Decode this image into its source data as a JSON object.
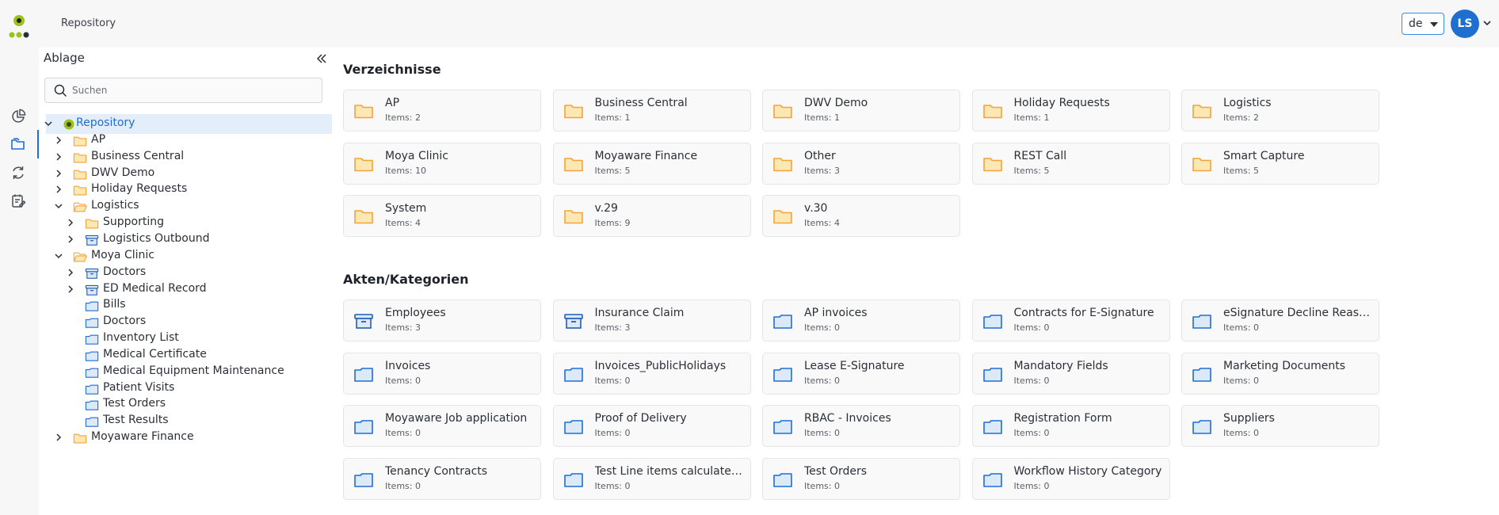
{
  "header": {
    "breadcrumb": "Repository",
    "language": "de",
    "avatar_initials": "LS"
  },
  "colors": {
    "accent": "#1f6fd1",
    "folder_yellow": "#f2a33a",
    "category_blue": "#1f6fd1",
    "selected_bg": "#e3eefa",
    "logo_lime": "#9bc21b"
  },
  "rail": {
    "items": [
      {
        "icon": "dashboard-icon"
      },
      {
        "icon": "folders-icon",
        "active": true
      },
      {
        "icon": "refresh-cycle-icon"
      },
      {
        "icon": "task-list-icon"
      }
    ]
  },
  "sidebar": {
    "title": "Ablage",
    "search_placeholder": "Suchen",
    "tree": [
      {
        "label": "Repository",
        "type": "root",
        "depth": 0,
        "expanded": true,
        "selected": true
      },
      {
        "label": "AP",
        "type": "folder",
        "depth": 1,
        "expanded": false
      },
      {
        "label": "Business Central",
        "type": "folder",
        "depth": 1,
        "expanded": false
      },
      {
        "label": "DWV Demo",
        "type": "folder",
        "depth": 1,
        "expanded": false
      },
      {
        "label": "Holiday Requests",
        "type": "folder",
        "depth": 1,
        "expanded": false
      },
      {
        "label": "Logistics",
        "type": "folder-open",
        "depth": 1,
        "expanded": true
      },
      {
        "label": "Supporting",
        "type": "folder",
        "depth": 2,
        "expanded": false
      },
      {
        "label": "Logistics Outbound",
        "type": "archive",
        "depth": 2,
        "expanded": false
      },
      {
        "label": "Moya Clinic",
        "type": "folder-open",
        "depth": 1,
        "expanded": true
      },
      {
        "label": "Doctors",
        "type": "archive",
        "depth": 2,
        "expanded": false
      },
      {
        "label": "ED Medical Record",
        "type": "archive",
        "depth": 2,
        "expanded": false
      },
      {
        "label": "Bills",
        "type": "category",
        "depth": 2,
        "leaf": true
      },
      {
        "label": "Doctors",
        "type": "category",
        "depth": 2,
        "leaf": true
      },
      {
        "label": "Inventory List",
        "type": "category",
        "depth": 2,
        "leaf": true
      },
      {
        "label": "Medical Certificate",
        "type": "category",
        "depth": 2,
        "leaf": true
      },
      {
        "label": "Medical Equipment Maintenance",
        "type": "category",
        "depth": 2,
        "leaf": true
      },
      {
        "label": "Patient Visits",
        "type": "category",
        "depth": 2,
        "leaf": true
      },
      {
        "label": "Test Orders",
        "type": "category",
        "depth": 2,
        "leaf": true
      },
      {
        "label": "Test Results",
        "type": "category",
        "depth": 2,
        "leaf": true
      },
      {
        "label": "Moyaware Finance",
        "type": "folder",
        "depth": 1,
        "expanded": false
      }
    ]
  },
  "main": {
    "directories_title": "Verzeichnisse",
    "directories": [
      {
        "name": "AP",
        "count": "Items: 2"
      },
      {
        "name": "Business Central",
        "count": "Items: 1"
      },
      {
        "name": "DWV Demo",
        "count": "Items: 1"
      },
      {
        "name": "Holiday Requests",
        "count": "Items: 1"
      },
      {
        "name": "Logistics",
        "count": "Items: 2"
      },
      {
        "name": "Moya Clinic",
        "count": "Items: 10"
      },
      {
        "name": "Moyaware Finance",
        "count": "Items: 5"
      },
      {
        "name": "Other",
        "count": "Items: 3"
      },
      {
        "name": "REST Call",
        "count": "Items: 5"
      },
      {
        "name": "Smart Capture",
        "count": "Items: 5"
      },
      {
        "name": "System",
        "count": "Items: 4"
      },
      {
        "name": "v.29",
        "count": "Items: 9"
      },
      {
        "name": "v.30",
        "count": "Items: 4"
      }
    ],
    "categories_title": "Akten/Kategorien",
    "categories": [
      {
        "name": "Employees",
        "count": "Items: 3",
        "icon": "archive-icon"
      },
      {
        "name": "Insurance Claim",
        "count": "Items: 3",
        "icon": "archive-icon"
      },
      {
        "name": "AP invoices",
        "count": "Items: 0",
        "icon": "category-folder-icon"
      },
      {
        "name": "Contracts for E-Signature",
        "count": "Items: 0",
        "icon": "category-folder-icon"
      },
      {
        "name": "eSignature Decline Reason...",
        "count": "Items: 0",
        "icon": "category-folder-icon"
      },
      {
        "name": "Invoices",
        "count": "Items: 0",
        "icon": "category-folder-icon"
      },
      {
        "name": "Invoices_PublicHolidays",
        "count": "Items: 0",
        "icon": "category-folder-icon"
      },
      {
        "name": "Lease E-Signature",
        "count": "Items: 0",
        "icon": "category-folder-icon"
      },
      {
        "name": "Mandatory Fields",
        "count": "Items: 0",
        "icon": "category-folder-icon"
      },
      {
        "name": "Marketing Documents",
        "count": "Items: 0",
        "icon": "category-folder-icon"
      },
      {
        "name": "Moyaware Job application",
        "count": "Items: 0",
        "icon": "category-folder-icon"
      },
      {
        "name": "Proof of Delivery",
        "count": "Items: 0",
        "icon": "category-folder-icon"
      },
      {
        "name": "RBAC - Invoices",
        "count": "Items: 0",
        "icon": "category-folder-icon"
      },
      {
        "name": "Registration Form",
        "count": "Items: 0",
        "icon": "category-folder-icon"
      },
      {
        "name": "Suppliers",
        "count": "Items: 0",
        "icon": "category-folder-icon"
      },
      {
        "name": "Tenancy Contracts",
        "count": "Items: 0",
        "icon": "category-folder-icon"
      },
      {
        "name": "Test Line items calculated ...",
        "count": "Items: 0",
        "icon": "category-folder-icon"
      },
      {
        "name": "Test Orders",
        "count": "Items: 0",
        "icon": "category-folder-icon"
      },
      {
        "name": "Workflow History Category",
        "count": "Items: 0",
        "icon": "category-folder-icon"
      }
    ]
  }
}
